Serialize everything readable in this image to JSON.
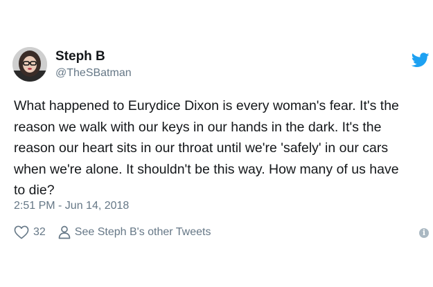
{
  "author": {
    "name": "Steph B",
    "handle": "@TheSBatman",
    "avatar_icon": "profile-photo"
  },
  "brand": {
    "icon": "twitter-bird-icon",
    "color": "#1da1f2"
  },
  "tweet": {
    "text": "What happened to Eurydice Dixon is every woman's fear. It's the\nreason we walk with our keys in our hands in the dark. It's the\nreason our heart sits in our throat until we're 'safely' in our cars\nwhen we're alone. It shouldn't be this way. How many of us have\nto die?",
    "timestamp": "2:51 PM - Jun 14, 2018"
  },
  "actions": {
    "like_count": "32",
    "other_tweets_label": "See Steph B's other Tweets",
    "info_icon": "info-icon"
  },
  "colors": {
    "text": "#14171a",
    "secondary": "#657786"
  }
}
